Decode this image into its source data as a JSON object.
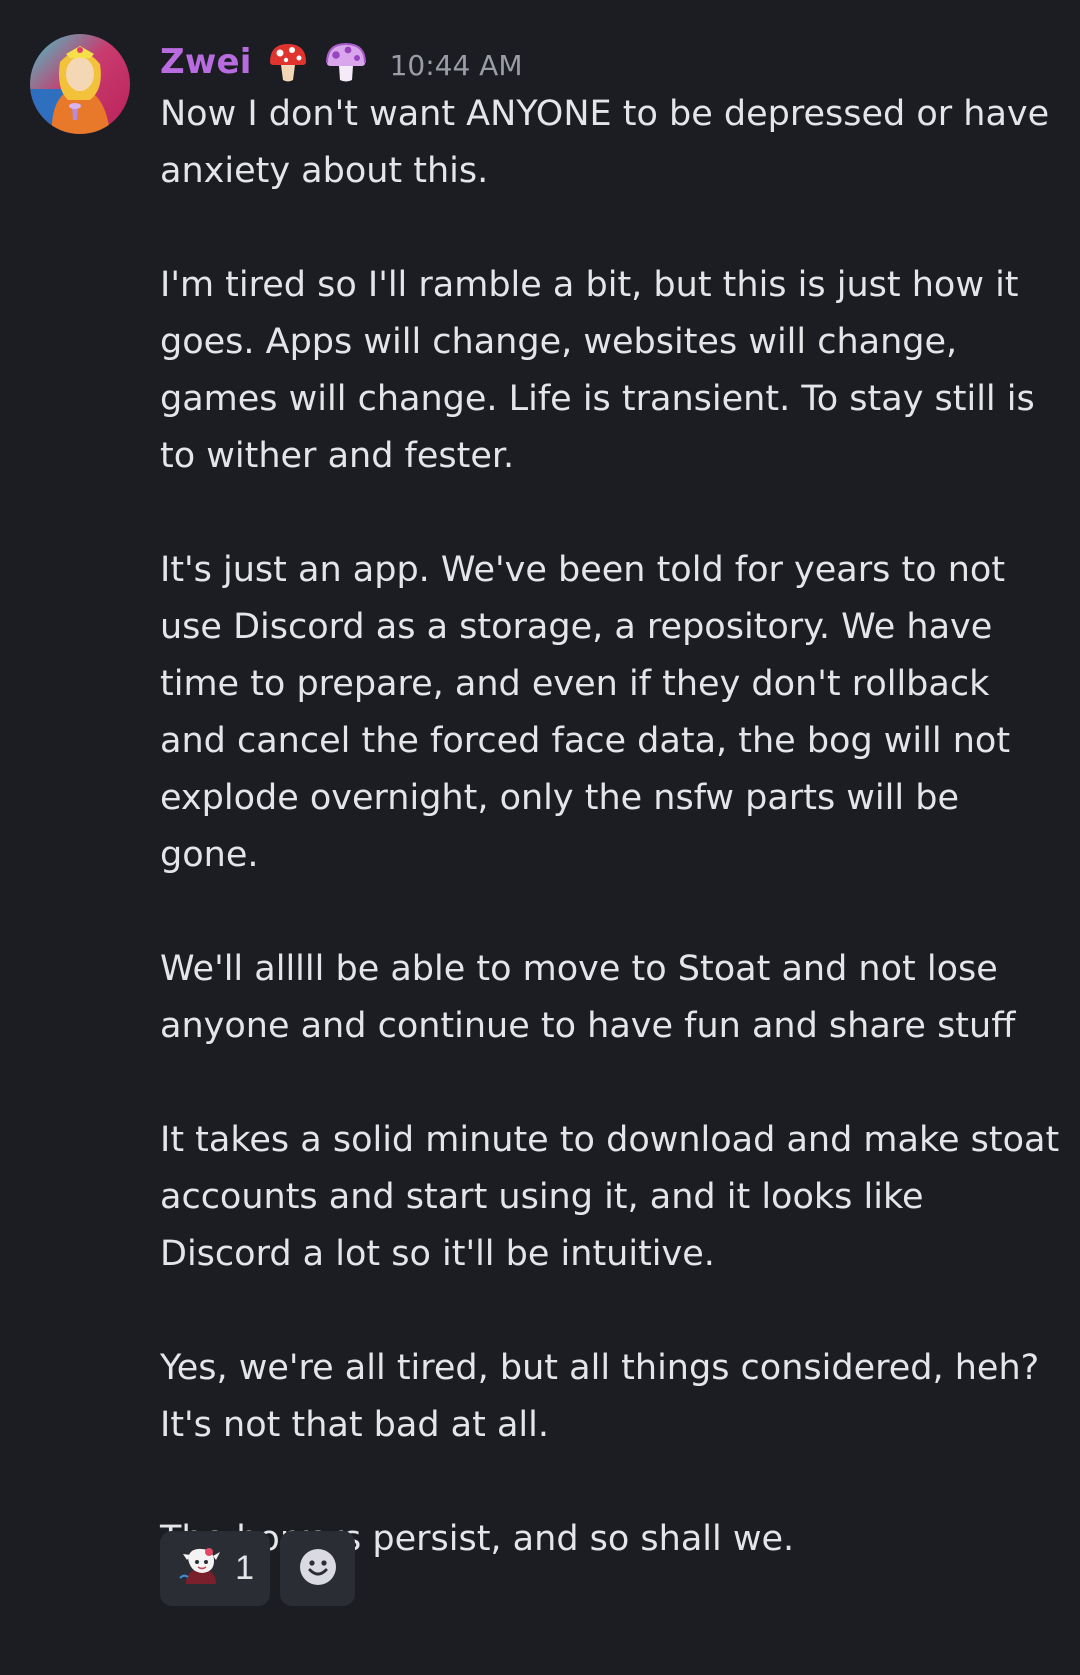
{
  "message": {
    "username": "Zwei",
    "role_icons": [
      "red-mushroom-icon",
      "purple-mushroom-icon"
    ],
    "timestamp": "10:44 AM",
    "paragraphs": [
      "Now I don't want ANYONE to be depressed or have anxiety about this.",
      "I'm tired so I'll ramble a bit, but this is just how it goes. Apps will change, websites will change, games will change. Life is transient. To stay still is to wither and fester.",
      "It's just an app. We've been told for years to not use Discord as a storage, a repository. We have time to prepare, and even if they don't rollback and cancel the forced face data, the bog will not explode overnight, only the nsfw parts will be gone.",
      "We'll alllll be able to move to Stoat and not lose anyone and continue to have fun and share stuff",
      "It takes a solid minute to download and make stoat accounts and start using it, and it looks like Discord a lot so it'll be intuitive.",
      "Yes, we're all tired, but all things considered, heh? It's not that bad at all.",
      "The horrors persist, and so shall we."
    ],
    "reactions": [
      {
        "emoji": "custom-character-emoji",
        "count": "1"
      }
    ],
    "add_reaction_icon": "add-reaction-smiley-icon"
  },
  "colors": {
    "background": "#1c1d22",
    "username": "#b86ce0",
    "timestamp": "#9a9da6",
    "text": "#e3e5e8",
    "reaction_bg": "#2b2d34"
  }
}
